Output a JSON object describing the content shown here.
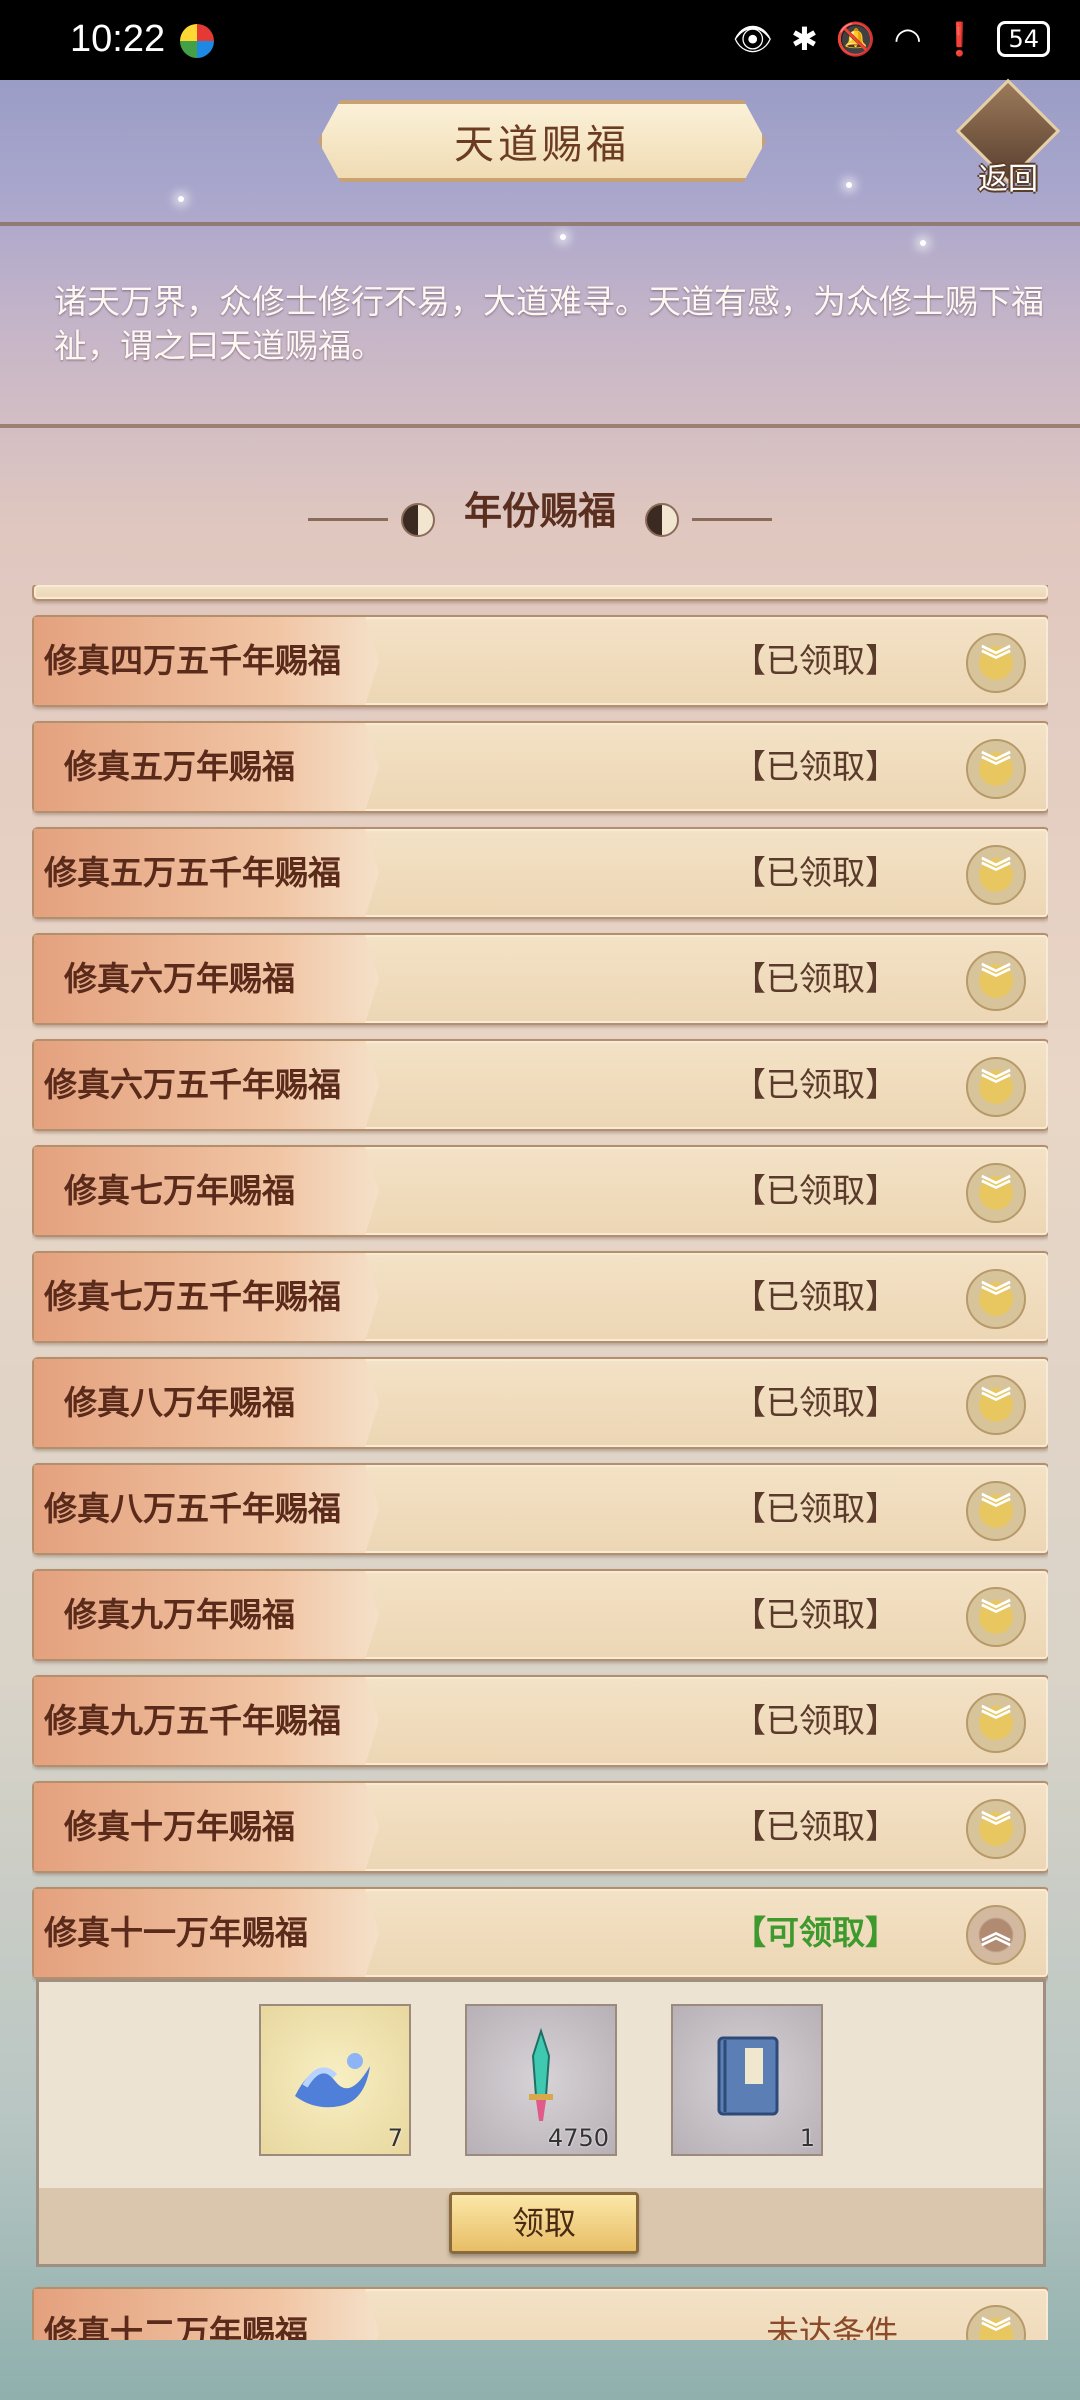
{
  "status_bar": {
    "time": "10:22",
    "battery": "54"
  },
  "header": {
    "title": "天道赐福",
    "back_label": "返回"
  },
  "intro": "诸天万界，众修士修行不易，大道难寻。天道有感，为众修士赐下福祉，谓之曰天道赐福。",
  "section_title": "年份赐福",
  "rows": [
    {
      "label": "修真四万五千年赐福",
      "status": "【已领取】"
    },
    {
      "label": "修真五万年赐福",
      "status": "【已领取】"
    },
    {
      "label": "修真五万五千年赐福",
      "status": "【已领取】"
    },
    {
      "label": "修真六万年赐福",
      "status": "【已领取】"
    },
    {
      "label": "修真六万五千年赐福",
      "status": "【已领取】"
    },
    {
      "label": "修真七万年赐福",
      "status": "【已领取】"
    },
    {
      "label": "修真七万五千年赐福",
      "status": "【已领取】"
    },
    {
      "label": "修真八万年赐福",
      "status": "【已领取】"
    },
    {
      "label": "修真八万五千年赐福",
      "status": "【已领取】"
    },
    {
      "label": "修真九万年赐福",
      "status": "【已领取】"
    },
    {
      "label": "修真九万五千年赐福",
      "status": "【已领取】"
    },
    {
      "label": "修真十万年赐福",
      "status": "【已领取】"
    },
    {
      "label": "修真十一万年赐福",
      "status": "【可领取】"
    },
    {
      "label": "修真十二万年赐福",
      "status": "未达条件"
    }
  ],
  "rewards": [
    {
      "icon": "water-wave-icon",
      "count": "7"
    },
    {
      "icon": "jade-sword-icon",
      "count": "4750"
    },
    {
      "icon": "blue-book-icon",
      "count": "1"
    }
  ],
  "claim_label": "领取",
  "colors": {
    "claimable": "#3f9a2e",
    "claimed": "#5a3a2a",
    "locked": "#8b4a2a"
  }
}
